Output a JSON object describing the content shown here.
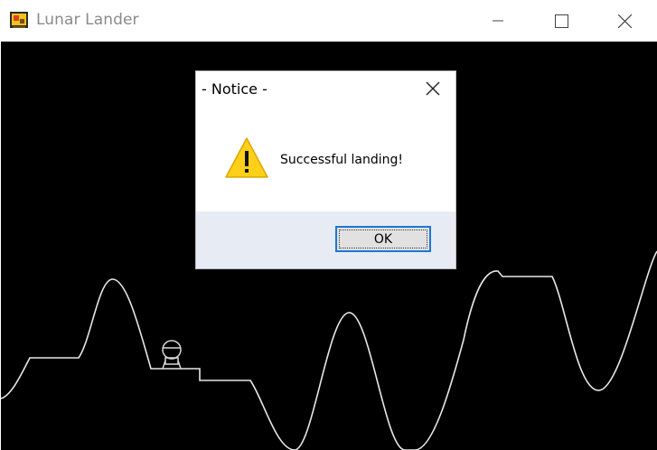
{
  "window": {
    "title": "Lunar Lander",
    "app_icon": "lander-app-icon",
    "controls": [
      "minimize-icon",
      "maximize-icon",
      "close-icon"
    ]
  },
  "game": {
    "background_color": "#000000",
    "terrain_color": "#ffffff",
    "lander_icon": "lander-icon"
  },
  "dialog": {
    "title": "- Notice -",
    "message": "Successful landing!",
    "icon": "warning-icon",
    "ok_label": "OK",
    "accent_color": "#1e78d0"
  }
}
